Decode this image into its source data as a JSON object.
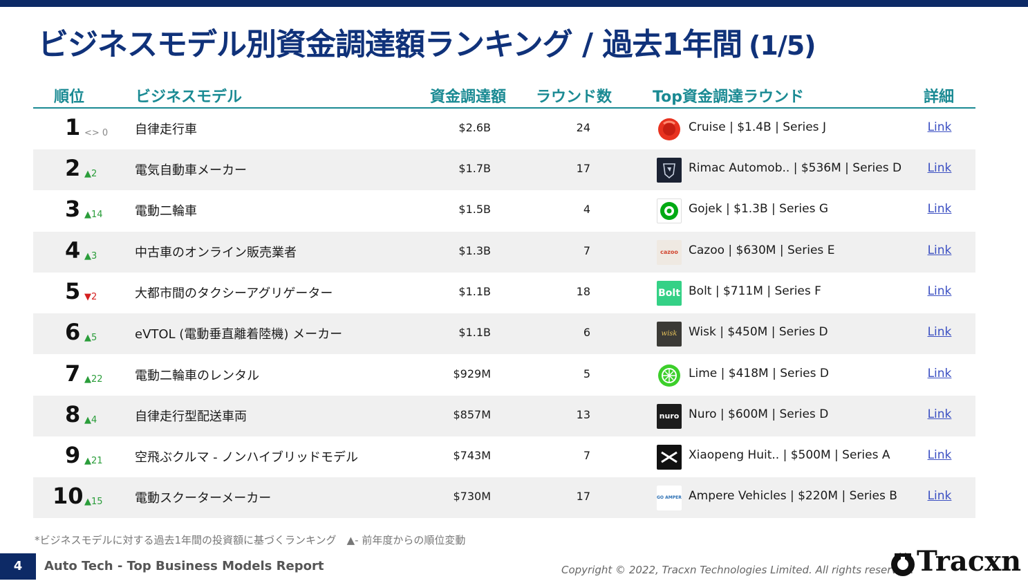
{
  "title": {
    "main": "ビジネスモデル別資金調達額ランキング / 過去1年間",
    "suffix": "(1/5)"
  },
  "headers": {
    "rank": "順位",
    "business_model": "ビジネスモデル",
    "amount": "資金調達額",
    "rounds": "ラウンド数",
    "top_round": "Top資金調達ラウンド",
    "details": "詳細"
  },
  "rows": [
    {
      "rank": "1",
      "change": "<> 0",
      "change_type": "same",
      "model": "自律走行車",
      "amount": "$2.6B",
      "rounds": "24",
      "logo": "cruise-logo",
      "top_round": "Cruise | $1.4B | Series J",
      "link": "Link"
    },
    {
      "rank": "2",
      "change": "▲2",
      "change_type": "up",
      "model": "電気自動車メーカー",
      "amount": "$1.7B",
      "rounds": "17",
      "logo": "rimac-logo",
      "top_round": "Rimac Automob.. | $536M | Series D",
      "link": "Link"
    },
    {
      "rank": "3",
      "change": "▲14",
      "change_type": "up",
      "model": "電動二輪車",
      "amount": "$1.5B",
      "rounds": "4",
      "logo": "gojek-logo",
      "top_round": "Gojek | $1.3B | Series G",
      "link": "Link"
    },
    {
      "rank": "4",
      "change": "▲3",
      "change_type": "up",
      "model": "中古車のオンライン販売業者",
      "amount": "$1.3B",
      "rounds": "7",
      "logo": "cazoo-logo",
      "top_round": "Cazoo | $630M | Series E",
      "link": "Link"
    },
    {
      "rank": "5",
      "change": "▼2",
      "change_type": "down",
      "model": "大都市間のタクシーアグリゲーター",
      "amount": "$1.1B",
      "rounds": "18",
      "logo": "bolt-logo",
      "top_round": "Bolt | $711M | Series F",
      "link": "Link"
    },
    {
      "rank": "6",
      "change": "▲5",
      "change_type": "up",
      "model": "eVTOL (電動垂直離着陸機) メーカー",
      "amount": "$1.1B",
      "rounds": "6",
      "logo": "wisk-logo",
      "top_round": "Wisk | $450M | Series D",
      "link": "Link"
    },
    {
      "rank": "7",
      "change": "▲22",
      "change_type": "up",
      "model": "電動二輪車のレンタル",
      "amount": "$929M",
      "rounds": "5",
      "logo": "lime-logo",
      "top_round": "Lime | $418M | Series D",
      "link": "Link"
    },
    {
      "rank": "8",
      "change": "▲4",
      "change_type": "up",
      "model": "自律走行型配送車両",
      "amount": "$857M",
      "rounds": "13",
      "logo": "nuro-logo",
      "top_round": "Nuro | $600M | Series D",
      "link": "Link"
    },
    {
      "rank": "9",
      "change": "▲21",
      "change_type": "up",
      "model": "空飛ぶクルマ - ノンハイブリッドモデル",
      "amount": "$743M",
      "rounds": "7",
      "logo": "xpeng-logo",
      "top_round": "Xiaopeng Huit.. | $500M | Series A",
      "link": "Link"
    },
    {
      "rank": "10",
      "change": "▲15",
      "change_type": "up",
      "model": "電動スクーターメーカー",
      "amount": "$730M",
      "rounds": "17",
      "logo": "ampere-logo",
      "top_round": "Ampere Vehicles | $220M | Series B",
      "link": "Link"
    }
  ],
  "logo_text": {
    "cazoo": "cazoo",
    "bolt": "Bolt",
    "wisk": "wisk",
    "nuro": "nuro",
    "ampere": "GO AMPERE"
  },
  "footnote": "*ビジネスモデルに対する過去1年間の投資額に基づくランキング　▲- 前年度からの順位変動",
  "footer": {
    "page": "4",
    "report": "Auto Tech - Top Business Models Report",
    "copyright": "Copyright © 2022, Tracxn Technologies Limited. All rights reserved.",
    "brand": "Tracxn"
  },
  "colors": {
    "navy": "#0d2a66",
    "title": "#10327a",
    "teal": "#1a8a93",
    "up": "#2a9d3a",
    "down": "#d42020",
    "link": "#3b4fc2"
  }
}
